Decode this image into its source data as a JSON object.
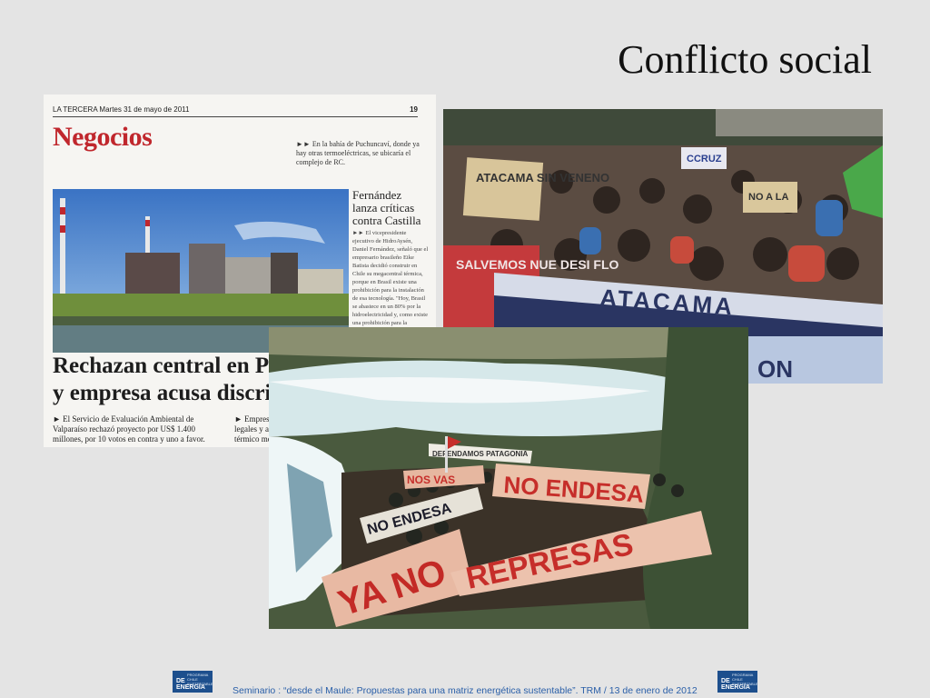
{
  "slide": {
    "title": "Conflicto social"
  },
  "newspaper": {
    "masthead": "LA TERCERA Martes 31 de mayo de 2011",
    "page_number": "19",
    "section": "Negocios",
    "caption": "►► En la bahía de Puchuncaví, donde ya hay otras termoeléctricas, se ubicaría el complejo de RC.",
    "side_headline": "Fernández lanza críticas contra Castilla",
    "side_body": "►► El vicepresidente ejecutivo de HidroAysén, Daniel Fernández, señaló que el empresario brasileño Eike Batista decidió construir en Chile su megacentral térmica, porque en Brasil existe una prohibición para la instalación de esa tecnología. \"Hoy, Brasil se abastece en un 80% por la hidroelectricidad y, como existe una prohibición para la construcción de centrales a carbón, Batista vino a Chile a construir la central",
    "headline_line1": "Rechazan central en Puc",
    "headline_line2": "y empresa acusa discrimi",
    "deck_left": "► El Servicio de Evaluación Ambiental de Valparaíso rechazó proyecto por US$ 1.400 millones, por 10 votos en contra y uno a favor.",
    "deck_right": "► Empresa de Southe legales y afirmó qu térmico menos con"
  },
  "protest_photo": {
    "signs": [
      "ATACAMA SIN VENENO",
      "CCRUZ",
      "NO A LA",
      "SALVEMOS NUE DESI FLO",
      "ATACAMA",
      "ON"
    ]
  },
  "river_photo": {
    "banners": [
      "YA NO",
      "REPRESAS",
      "NO ENDESA",
      "NO ENDESA",
      "NOS VAS",
      "DEFENDAMOS PATAGONIA"
    ]
  },
  "footer": {
    "text": "Seminario : “desde el Maule: Propuestas para una matriz energética sustentable”.  TRM  /  13 de enero de 2012",
    "logo_top": "PROGRAMA CHILE SUSTENTABLE",
    "logo_bottom": "DE ENERGÍA"
  },
  "colors": {
    "background": "#e4e4e4",
    "section_red": "#c0272d",
    "footer_blue": "#2a5fa8",
    "logo_blue": "#1d4f8d"
  }
}
